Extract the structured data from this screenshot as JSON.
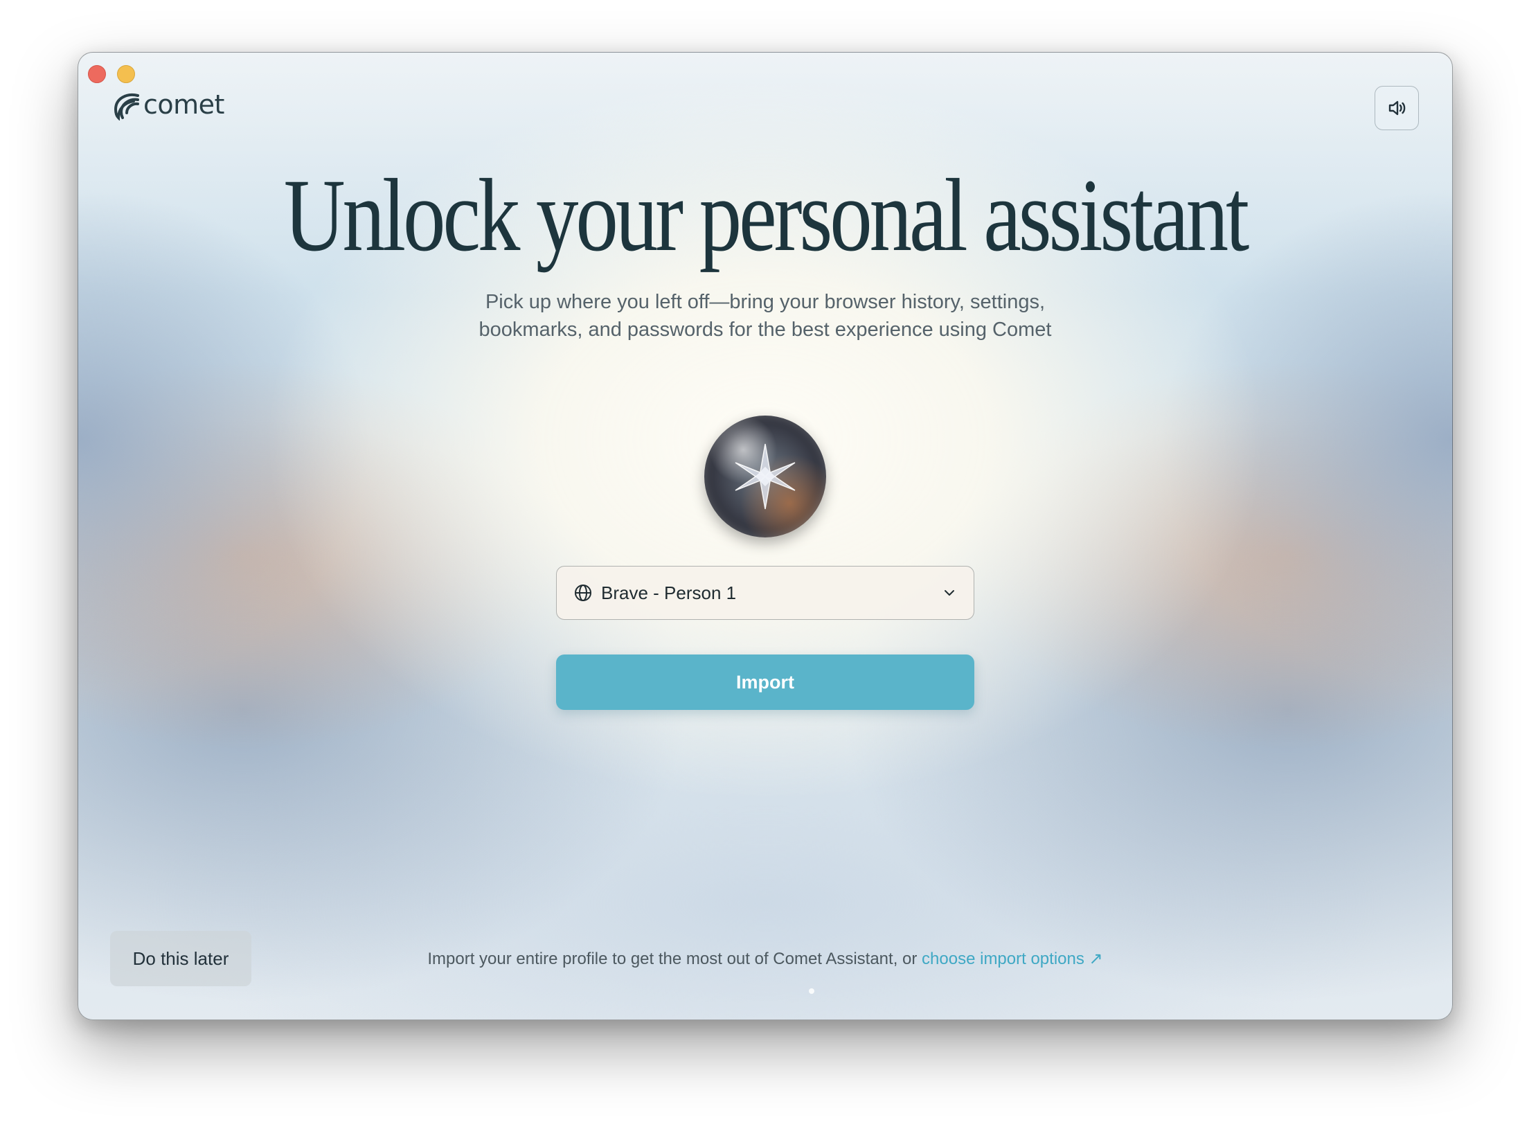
{
  "window": {
    "title": ""
  },
  "brand": {
    "name": "comet",
    "logo_icon": "comet-logo-icon"
  },
  "header": {
    "sound_icon": "speaker-icon"
  },
  "hero": {
    "title": "Unlock your personal assistant",
    "subtitle_line1": "Pick up where you left off—bring your browser history, settings,",
    "subtitle_line2": "bookmarks, and passwords for the best experience using Comet"
  },
  "orb": {
    "icon": "star-orb-icon"
  },
  "profile_select": {
    "icon": "globe-icon",
    "selected": "Brave - Person 1",
    "chevron": "chevron-down-icon"
  },
  "actions": {
    "import_label": "Import",
    "later_label": "Do this later"
  },
  "footer": {
    "note": "Import your entire profile to get the most out of Comet Assistant, or ",
    "link_label": "choose import options",
    "link_icon": "↗"
  },
  "colors": {
    "accent": "#5ab4ca",
    "link": "#3fa8c4",
    "heading": "#1d353d",
    "close": "#ed6a5e",
    "minimize": "#f4bf4f"
  }
}
